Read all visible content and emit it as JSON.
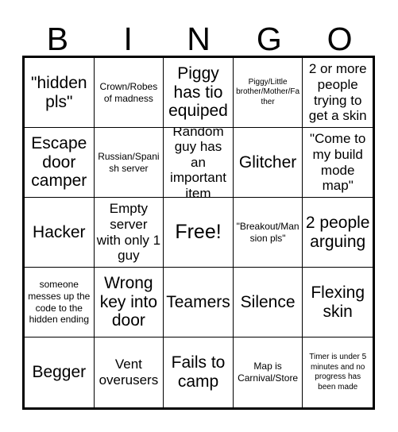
{
  "header": {
    "letters": [
      "B",
      "I",
      "N",
      "G",
      "O"
    ]
  },
  "grid": {
    "rows": 5,
    "columns": 5,
    "free_space_index": 12,
    "cells": [
      {
        "text": "\"hidden pls\"",
        "size": "lg"
      },
      {
        "text": "Crown/Robes of madness",
        "size": "sm"
      },
      {
        "text": "Piggy has tio equiped",
        "size": "lg"
      },
      {
        "text": "Piggy/Little brother/Mother/Father",
        "size": "xs"
      },
      {
        "text": "2 or more people trying to get a skin",
        "size": "md"
      },
      {
        "text": "Escape door camper",
        "size": "lg"
      },
      {
        "text": "Russian/Spanish server",
        "size": "sm"
      },
      {
        "text": "Random guy has an important item",
        "size": "md"
      },
      {
        "text": "Glitcher",
        "size": "lg"
      },
      {
        "text": "\"Come to my build mode map\"",
        "size": "md"
      },
      {
        "text": "Hacker",
        "size": "lg"
      },
      {
        "text": "Empty server with only 1 guy",
        "size": "md"
      },
      {
        "text": "Free!",
        "size": "xl"
      },
      {
        "text": "\"Breakout/Mansion pls\"",
        "size": "sm"
      },
      {
        "text": "2 people arguing",
        "size": "lg"
      },
      {
        "text": "someone messes up the code to the hidden ending",
        "size": "sm"
      },
      {
        "text": "Wrong key into door",
        "size": "lg"
      },
      {
        "text": "Teamers",
        "size": "lg"
      },
      {
        "text": "Silence",
        "size": "lg"
      },
      {
        "text": "Flexing skin",
        "size": "lg"
      },
      {
        "text": "Begger",
        "size": "lg"
      },
      {
        "text": "Vent overusers",
        "size": "md"
      },
      {
        "text": "Fails to camp",
        "size": "lg"
      },
      {
        "text": "Map is Carnival/Store",
        "size": "sm"
      },
      {
        "text": "Timer is under 5 minutes and no progress has been made",
        "size": "xs"
      }
    ]
  },
  "colors": {
    "background": "#ffffff",
    "text": "#000000",
    "border": "#000000"
  }
}
